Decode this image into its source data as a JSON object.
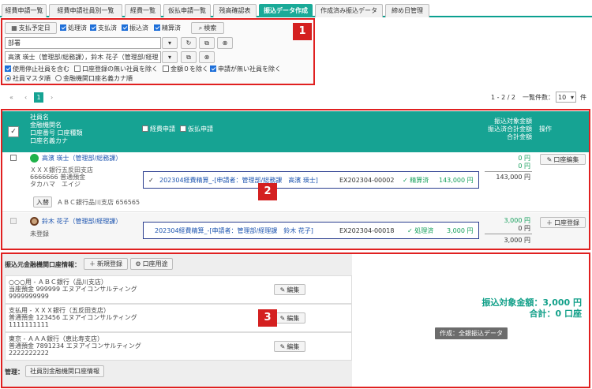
{
  "tabs": [
    "経費申請一覧",
    "経費申請社員別一覧",
    "経費一覧",
    "仮払申請一覧",
    "残高確認表",
    "振込データ作成",
    "作成済み振込データ",
    "締め日管理"
  ],
  "active_tab": 5,
  "filters": {
    "date_button": "支払予定日",
    "status_checks": [
      "処理済",
      "支払済",
      "振込済",
      "精算済"
    ],
    "search_button": "検索",
    "dept_value": "部署",
    "employee_value": "高濱 瑛士（管理部/総務課），鈴木 花子（管理部/経理",
    "options_row1": [
      "使用停止社員を含む",
      "口座登録の無い社員を除く",
      "金額０を除く",
      "申請が無い社員を除く"
    ],
    "sort_options": [
      "社員マスタ順",
      "金融機関口座名義カナ順"
    ]
  },
  "badges": [
    "1",
    "2",
    "3"
  ],
  "pager": {
    "first": "«",
    "prev": "‹",
    "page": "1",
    "next": "›",
    "range": "1 - 2 / 2",
    "per_page_label": "一覧件数：",
    "per_page": "10",
    "unit": "件"
  },
  "table_header": {
    "col1": [
      "社員名",
      "金融機関名",
      "口座番号 口座種類",
      "口座名義カナ"
    ],
    "col2a": "経費申請",
    "col2b": "仮払申請",
    "amounts": [
      "振込対象金額",
      "振込済合計金額",
      "合計金額"
    ],
    "op": "操作"
  },
  "rows": [
    {
      "name": "高濱 瑛士（管理部/総務課）",
      "bank": "ＸＸＸ銀行五反田支店",
      "account": "6666666 普通預金",
      "kana": "タカハマ　エイジ",
      "transfer_btn": "入替",
      "alt_bank": "ＡＢＣ銀行品川支店 656565",
      "app_check": "✓",
      "app_title": "202304経費精算_-[申請者：管理部/総務課　高濱 瑛士]",
      "app_id": "EX202304-00002",
      "app_status": "✓ 精算済",
      "app_amount": "143,000 円",
      "amt1": "0 円",
      "amt2": "0 円",
      "amt3": "143,000 円",
      "action": "口座編集"
    },
    {
      "name": "鈴木 花子（管理部/経理課）",
      "unregistered": "未登録",
      "app_title": "202304経費精算_-[申請者：管理部/経理課　鈴木 花子]",
      "app_id": "EX202304-00018",
      "app_status": "✓ 処理済",
      "app_amount": "3,000 円",
      "amt1": "3,000 円",
      "amt2": "0 円",
      "amt3": "3,000 円",
      "action": "口座登録"
    }
  ],
  "source": {
    "title": "振込元金融機関口座情報：",
    "new_btn": "新規登録",
    "use_btn": "口座用途",
    "accounts": [
      {
        "l1": "○○○用 - ＡＢＣ銀行（品川支店）",
        "l2": "当座預金 999999 エヌアイコンサルティング",
        "l3": "9999999999"
      },
      {
        "l1": "支払用 - ＸＸＸ銀行（五反田支店）",
        "l2": "普通預金 123456 エヌアイコンサルティング",
        "l3": "1111111111"
      },
      {
        "l1": "東京 - ＡＡＡ銀行（恵比寿支店）",
        "l2": "普通預金 7891234 エヌアイコンサルティング",
        "l3": "2222222222"
      }
    ],
    "edit_btn": "編集",
    "manage_label": "管理：",
    "manage_btn": "社員別金融機関口座情報"
  },
  "summary": {
    "target": "振込対象金額：3,000 円",
    "total": "合計：0 口座",
    "create_btn": "作成：全銀振込データ"
  },
  "colors": {
    "accent": "#16a393",
    "badge": "#d42020",
    "link": "#1e55b0"
  }
}
